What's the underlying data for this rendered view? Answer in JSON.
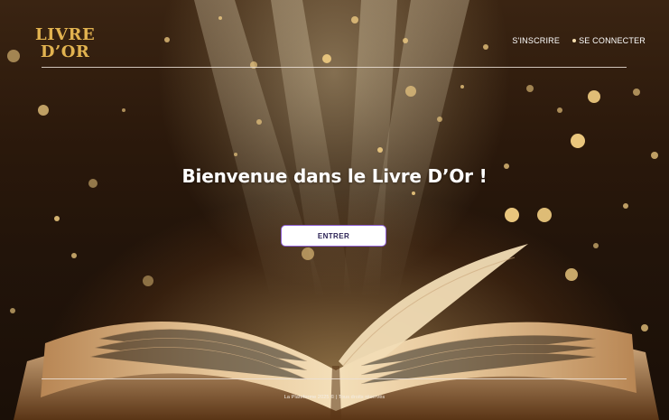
{
  "header": {
    "logo_line1": "LIVRE",
    "logo_line2": "D’OR",
    "nav": {
      "signup_label": "S'INSCRIRE",
      "login_label": "SE CONNECTER"
    }
  },
  "hero": {
    "title": "Bienvenue dans le Livre D’Or !",
    "enter_button_label": "ENTRER"
  },
  "footer": {
    "copyright": "La Plateforme 2025 © | Tous droits réservés"
  },
  "colors": {
    "logo": "#e2b350",
    "button_border": "#8d5fd3",
    "button_text": "#2b2255",
    "rule": "#ebe1d7",
    "text": "#ffffff"
  }
}
